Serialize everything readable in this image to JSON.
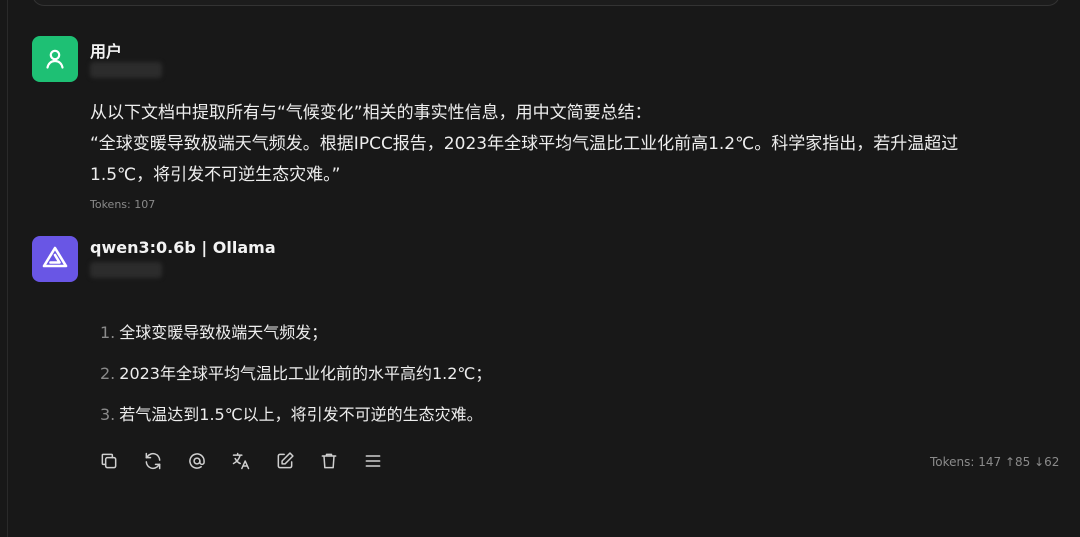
{
  "user_message": {
    "name": "用户",
    "line1": "从以下文档中提取所有与“气候变化”相关的事实性信息，用中文简要总结：",
    "line2": "“全球变暖导致极端天气频发。根据IPCC报告，2023年全球平均气温比工业化前高1.2℃。科学家指出，若升温超过",
    "line3": "1.5℃，将引发不可逆生态灾难。”",
    "tokens": "Tokens: 107"
  },
  "assistant_message": {
    "name": "qwen3:0.6b | Ollama",
    "items": [
      {
        "num": "1.",
        "text": "全球变暖导致极端天气频发；"
      },
      {
        "num": "2.",
        "text": "2023年全球平均气温比工业化前的水平高约1.2℃；"
      },
      {
        "num": "3.",
        "text": "若气温达到1.5℃以上，将引发不可逆的生态灾难。"
      }
    ],
    "tokens": "Tokens: 147 ↑85 ↓62"
  },
  "toolbar": {
    "icons": [
      "copy-icon",
      "regenerate-icon",
      "mention-icon",
      "translate-icon",
      "edit-icon",
      "delete-icon",
      "menu-icon"
    ]
  },
  "colors": {
    "user_avatar": "#1ec074",
    "bot_avatar": "#6956e5",
    "background": "#181818"
  }
}
